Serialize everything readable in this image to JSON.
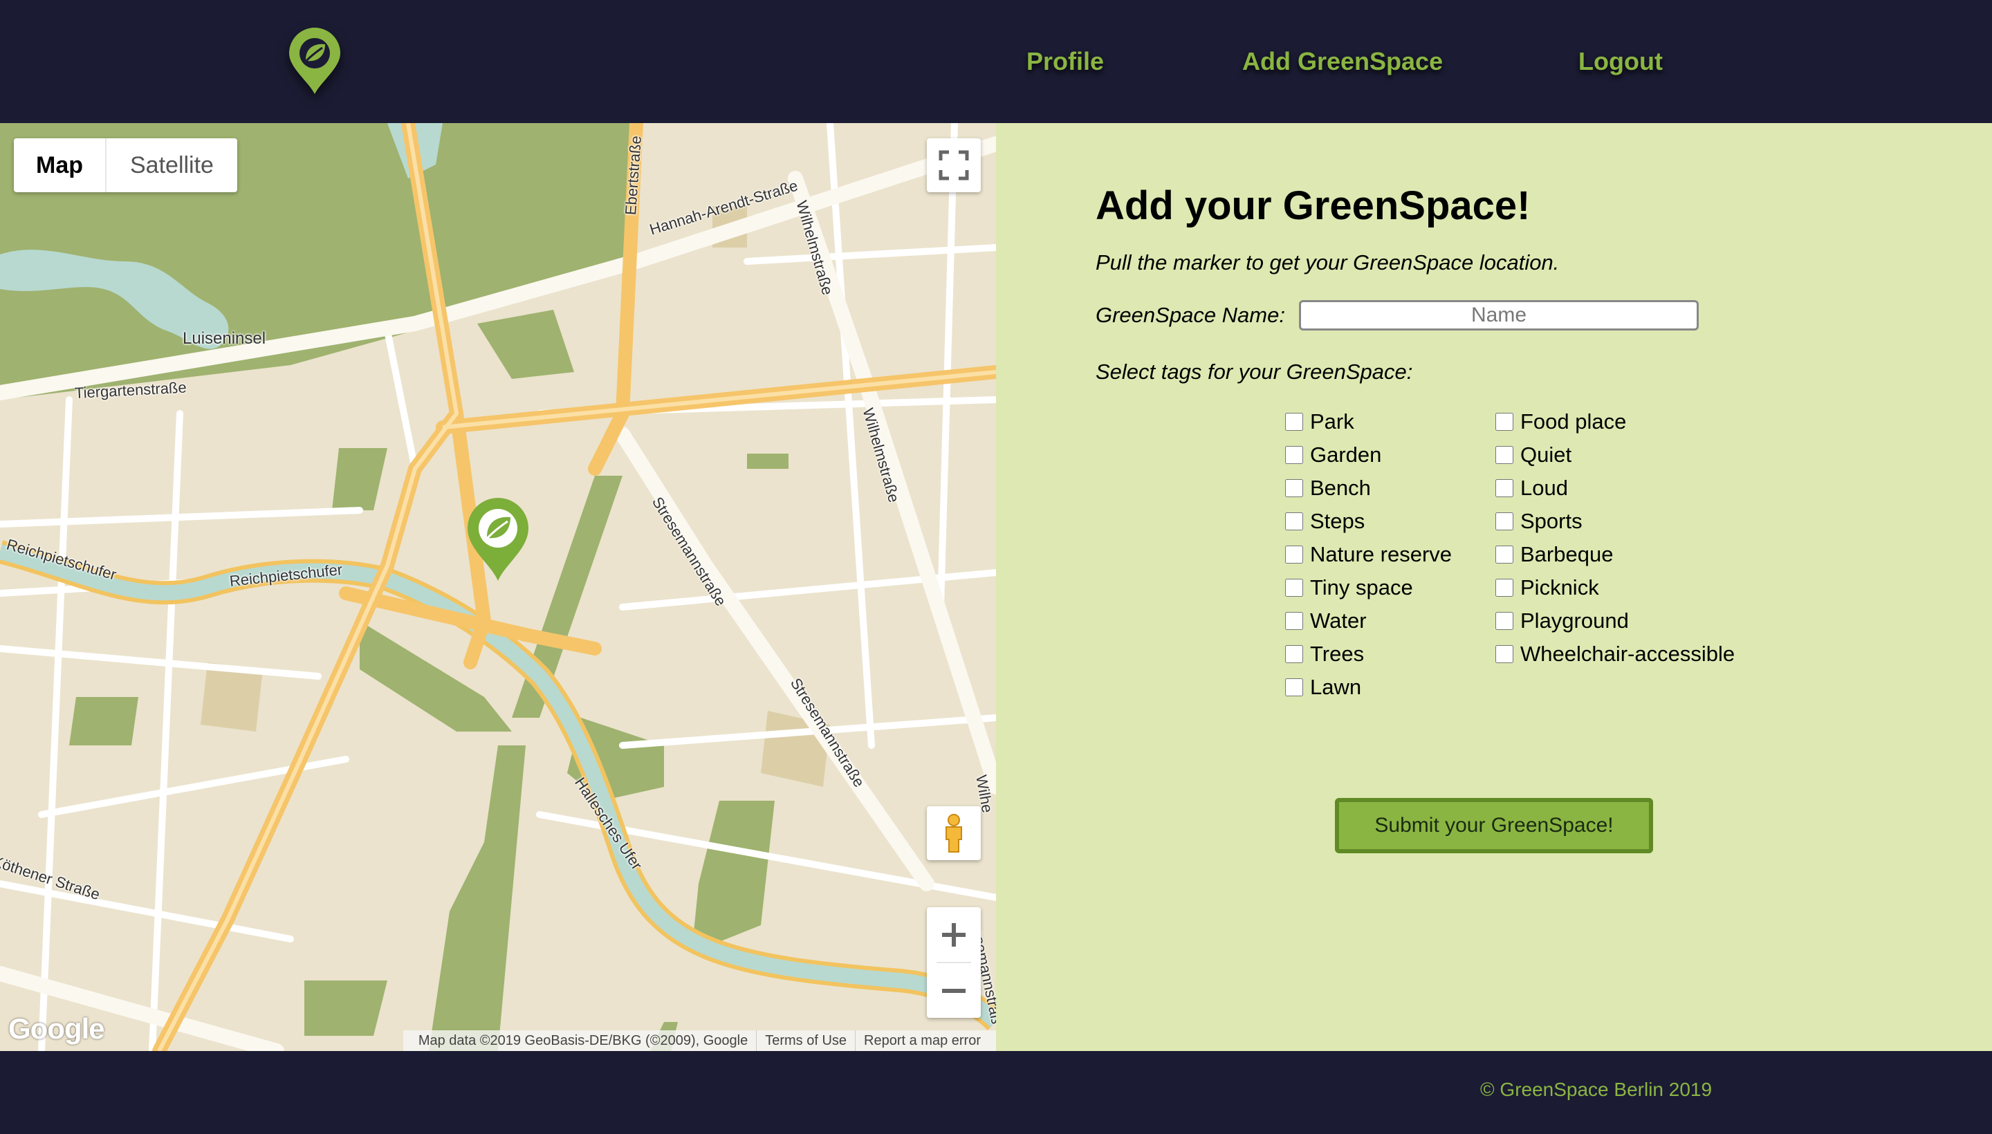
{
  "header": {
    "logo_alt": "GreenSpace logo",
    "nav": [
      {
        "label": "Profile"
      },
      {
        "label": "Add GreenSpace"
      },
      {
        "label": "Logout"
      }
    ]
  },
  "map": {
    "type_buttons": {
      "map": "Map",
      "satellite": "Satellite"
    },
    "attribution": {
      "data": "Map data ©2019 GeoBasis-DE/BKG (©2009), Google",
      "terms": "Terms of Use",
      "report": "Report a map error"
    },
    "google_logo": "Google",
    "street_labels": [
      "Luiseninsel",
      "Tiergartenstraße",
      "Ebertstraße",
      "Hannah-Arendt-Straße",
      "Wilhelmstraße",
      "Wilhelmstraße",
      "Stresemannstraße",
      "Stresemannstraße",
      "Reichpietschufer",
      "Reichpietschufer",
      "Hallesches Ufer",
      "Köthener Straße",
      "Wilhe",
      "asemannstraß"
    ]
  },
  "form": {
    "title": "Add your GreenSpace!",
    "instructions": "Pull the marker to get your GreenSpace location.",
    "name_label": "GreenSpace Name:",
    "name_placeholder": "Name",
    "name_value": "",
    "tags_label": "Select tags for your GreenSpace:",
    "tags_left": [
      "Park",
      "Garden",
      "Bench",
      "Steps",
      "Nature reserve",
      "Tiny space",
      "Water",
      "Trees",
      "Lawn"
    ],
    "tags_right": [
      "Food place",
      "Quiet",
      "Loud",
      "Sports",
      "Barbeque",
      "Picknick",
      "Playground",
      "Wheelchair-accessible"
    ],
    "submit_label": "Submit your GreenSpace!"
  },
  "footer": {
    "copyright": "© GreenSpace Berlin 2019"
  },
  "colors": {
    "header_bg": "#1b1b33",
    "accent_green": "#8ab542",
    "panel_bg": "#dee8b2",
    "submit_border": "#5f8a25",
    "map_land": "#ebe3cd",
    "map_park": "#9fb26f",
    "map_road_major": "#f6c56a",
    "map_water": "#b8d9d0"
  },
  "icons": [
    "leaf-pin-icon",
    "fullscreen-icon",
    "pegman-icon",
    "zoom-in-icon",
    "zoom-out-icon"
  ]
}
